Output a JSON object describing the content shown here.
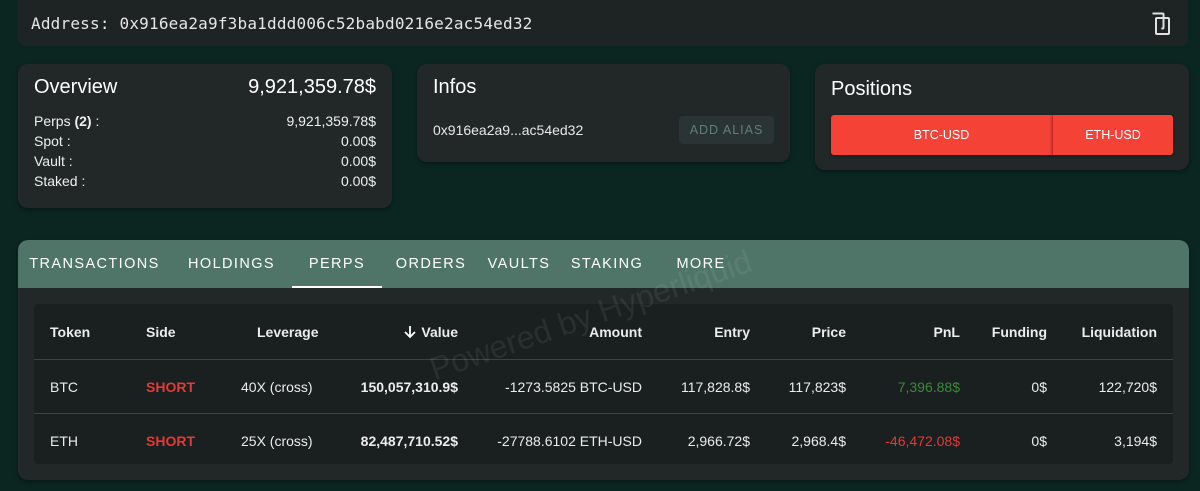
{
  "address_bar": {
    "label": "Address:",
    "value": "0x916ea2a9f3ba1ddd006c52babd0216e2ac54ed32",
    "copy_icon": "copy-icon"
  },
  "overview": {
    "title": "Overview",
    "total": "9,921,359.78$",
    "rows": [
      {
        "label_prefix": "Perps ",
        "label_count": "(2)",
        "label_suffix": " :",
        "value": "9,921,359.78$"
      },
      {
        "label_prefix": "Spot :",
        "label_count": "",
        "label_suffix": "",
        "value": "0.00$"
      },
      {
        "label_prefix": "Vault :",
        "label_count": "",
        "label_suffix": "",
        "value": "0.00$"
      },
      {
        "label_prefix": "Staked :",
        "label_count": "",
        "label_suffix": "",
        "value": "0.00$"
      }
    ]
  },
  "infos": {
    "title": "Infos",
    "short_address": "0x916ea2a9...ac54ed32",
    "alias_button": "ADD ALIAS"
  },
  "positions": {
    "title": "Positions",
    "buttons": [
      "BTC-USD",
      "ETH-USD"
    ],
    "button_color": "#f44336"
  },
  "tabs": [
    "TRANSACTIONS",
    "HOLDINGS",
    "PERPS",
    "ORDERS",
    "VAULTS",
    "STAKING",
    "MORE"
  ],
  "active_tab": "PERPS",
  "table": {
    "columns": [
      "Token",
      "Side",
      "Leverage",
      "Value",
      "Amount",
      "Entry",
      "Price",
      "PnL",
      "Funding",
      "Liquidation"
    ],
    "sort_icon": "arrow-down-icon",
    "rows": [
      {
        "token": "BTC",
        "side": "SHORT",
        "leverage": "40X (cross)",
        "value": "150,057,310.9$",
        "amount": "-1273.5825 BTC-USD",
        "entry": "117,828.8$",
        "price": "117,823$",
        "pnl": "7,396.88$",
        "funding": "0$",
        "liquidation": "122,720$"
      },
      {
        "token": "ETH",
        "side": "SHORT",
        "leverage": "25X (cross)",
        "value": "82,487,710.52$",
        "amount": "-27788.6102 ETH-USD",
        "entry": "2,966.72$",
        "price": "2,968.4$",
        "pnl": "-46,472.08$",
        "funding": "0$",
        "liquidation": "3,194$"
      }
    ]
  },
  "watermark": "Powered by Hyperliquid",
  "colors": {
    "background": "#0b2621",
    "card": "#222828",
    "tab_bar": "#4f7569",
    "short": "#e53935",
    "pnl_positive": "#3a8a3a",
    "pnl_negative": "#e53935"
  }
}
